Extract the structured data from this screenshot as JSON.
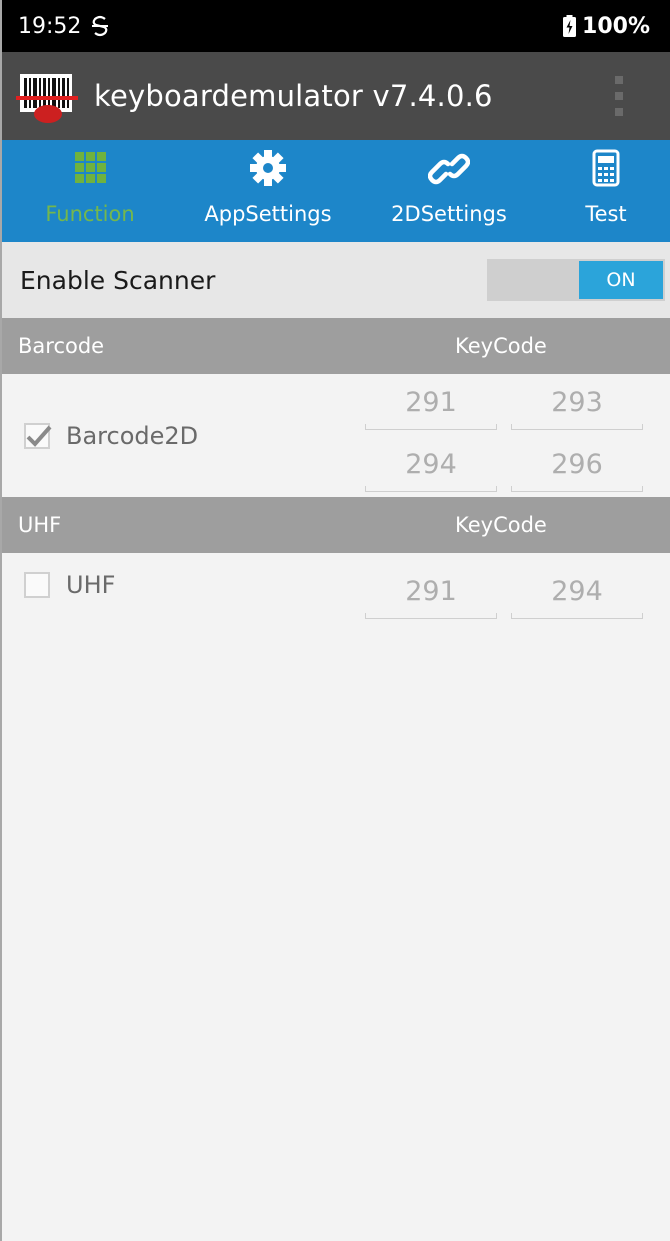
{
  "status_bar": {
    "time": "19:52",
    "battery": "100%"
  },
  "app_bar": {
    "title": "keyboardemulator v7.4.0.6"
  },
  "tabs": [
    {
      "label": "Function",
      "icon": "grid-icon",
      "active": true
    },
    {
      "label": "AppSettings",
      "icon": "gear-icon",
      "active": false
    },
    {
      "label": "2DSettings",
      "icon": "link-icon",
      "active": false
    },
    {
      "label": "Test",
      "icon": "calculator-icon",
      "active": false
    }
  ],
  "enable_scanner": {
    "label": "Enable Scanner",
    "toggle_text": "ON",
    "on": true
  },
  "barcode_section": {
    "header_left": "Barcode",
    "header_right": "KeyCode",
    "item": {
      "label": "Barcode2D",
      "checked": true,
      "keycodes": [
        "291",
        "293",
        "294",
        "296"
      ]
    }
  },
  "uhf_section": {
    "header_left": "UHF",
    "header_right": "KeyCode",
    "item": {
      "label": "UHF",
      "checked": false,
      "keycodes": [
        "291",
        "294"
      ]
    }
  },
  "colors": {
    "status_bar": "#000000",
    "app_bar": "#4a4a4a",
    "tab_bar": "#1d86c9",
    "active_tab_label": "#74b74d",
    "toggle_on": "#2ba4da",
    "section_header": "#9e9e9e"
  }
}
